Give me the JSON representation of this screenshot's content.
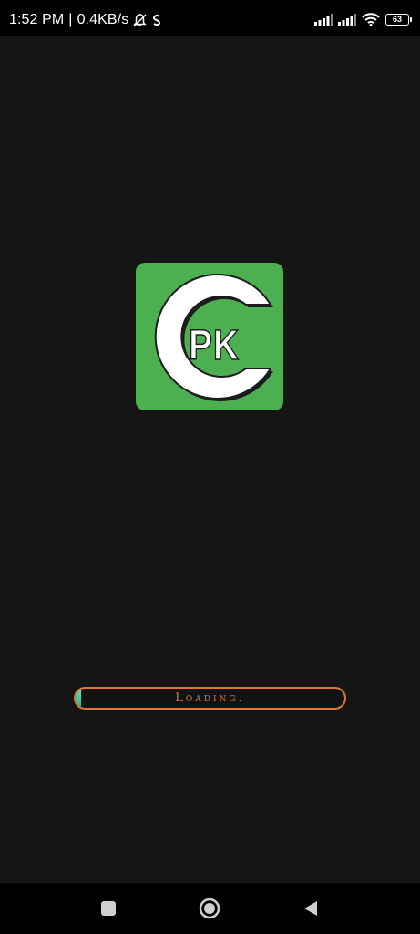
{
  "status_bar": {
    "time": "1:52 PM",
    "separator": "|",
    "network_speed": "0.4KB/s",
    "icons": [
      "bell-muted-icon",
      "sync-icon",
      "signal-icon",
      "signal-icon",
      "wifi-icon"
    ],
    "battery_level": "63"
  },
  "logo": {
    "letter": "C",
    "text": "PK",
    "background_color": "#4cb050"
  },
  "loading": {
    "label": "Loading.",
    "progress_percent": 2,
    "border_color": "#e0773a"
  },
  "nav_bar": {
    "buttons": [
      "recents-square-icon",
      "home-circle-icon",
      "back-triangle-icon"
    ]
  }
}
